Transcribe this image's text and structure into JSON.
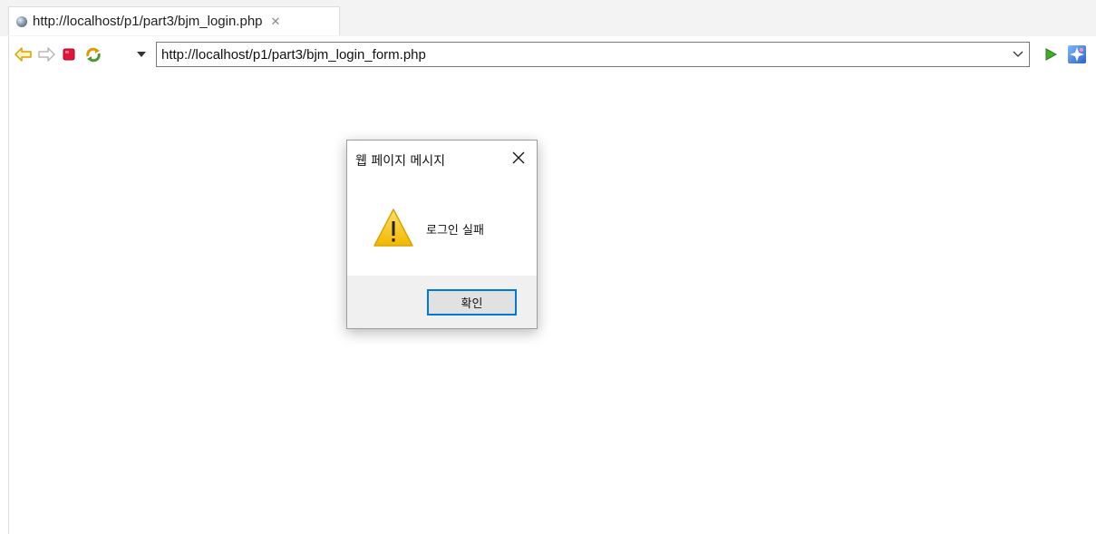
{
  "tab": {
    "title": "http://localhost/p1/part3/bjm_login.php",
    "close_icon": "close-icon"
  },
  "toolbar": {
    "back_icon": "back-arrow-icon",
    "forward_icon": "forward-arrow-icon",
    "stop_icon": "stop-icon",
    "refresh_icon": "refresh-icon",
    "url": "http://localhost/p1/part3/bjm_login_form.php",
    "go_icon": "go-icon",
    "browser_icon": "browser-app-icon"
  },
  "dialog": {
    "title": "웹 페이지 메시지",
    "message": "로그인 실패",
    "ok_label": "확인",
    "icon": "warning-icon"
  },
  "colors": {
    "accent": "#0078d7",
    "warning": "#f5c400",
    "stop": "#e0143c",
    "go": "#3fae29"
  }
}
